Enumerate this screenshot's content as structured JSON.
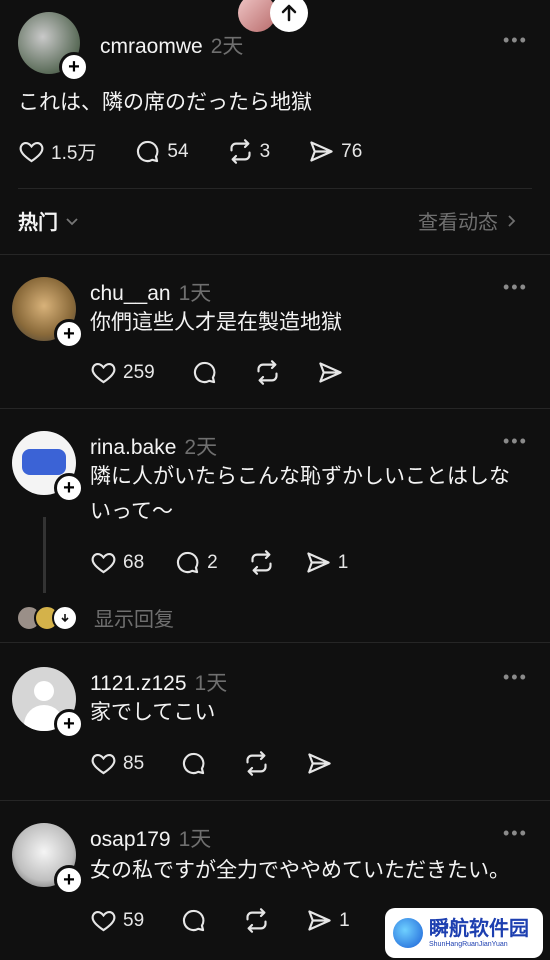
{
  "post": {
    "author": "cmraomwe",
    "time": "2天",
    "text": "これは、隣の席のだったら地獄",
    "likes": "1.5万",
    "comments": "54",
    "reposts": "3",
    "shares": "76"
  },
  "tabs": {
    "hot_label": "热门",
    "view_activity_label": "查看动态"
  },
  "replies": [
    {
      "author": "chu__an",
      "time": "1天",
      "text": "你們這些人才是在製造地獄",
      "likes": "259"
    },
    {
      "author": "rina.bake",
      "time": "2天",
      "text_line1": "隣に人がいたらこんな恥ずかしいことはしな",
      "text_line2": "いって〜",
      "likes": "68",
      "comments": "2",
      "shares": "1",
      "show_replies": "显示回复"
    },
    {
      "author": "1121.z125",
      "time": "1天",
      "text": "家でしてこい",
      "likes": "85"
    },
    {
      "author": "osap179",
      "time": "1天",
      "text": "女の私ですが全力でややめていただきたい。",
      "likes": "59",
      "shares": "1"
    }
  ],
  "watermark": {
    "title": "瞬航软件园",
    "subtitle": "ShunHangRuanJianYuan"
  }
}
